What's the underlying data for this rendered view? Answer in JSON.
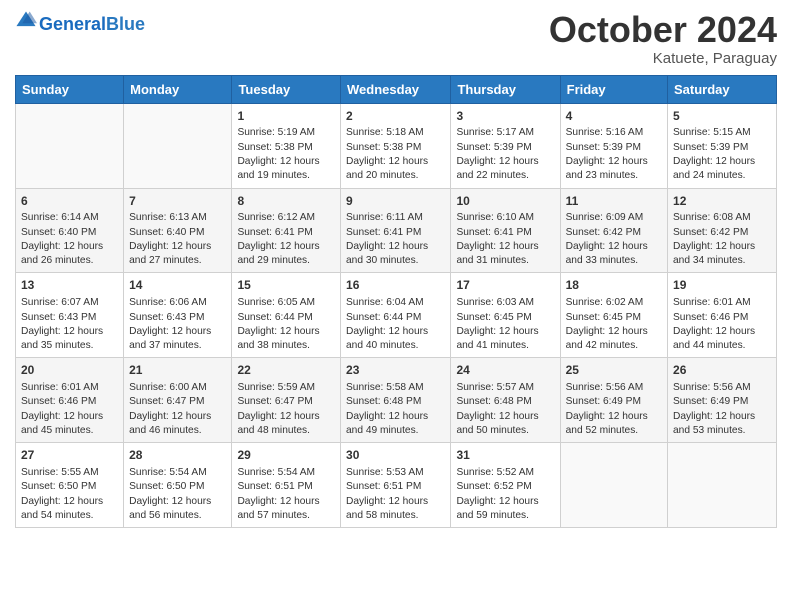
{
  "header": {
    "logo_general": "General",
    "logo_blue": "Blue",
    "month_title": "October 2024",
    "subtitle": "Katuete, Paraguay"
  },
  "weekdays": [
    "Sunday",
    "Monday",
    "Tuesday",
    "Wednesday",
    "Thursday",
    "Friday",
    "Saturday"
  ],
  "weeks": [
    [
      {
        "day": "",
        "sunrise": "",
        "sunset": "",
        "daylight": ""
      },
      {
        "day": "",
        "sunrise": "",
        "sunset": "",
        "daylight": ""
      },
      {
        "day": "1",
        "sunrise": "Sunrise: 5:19 AM",
        "sunset": "Sunset: 5:38 PM",
        "daylight": "Daylight: 12 hours and 19 minutes."
      },
      {
        "day": "2",
        "sunrise": "Sunrise: 5:18 AM",
        "sunset": "Sunset: 5:38 PM",
        "daylight": "Daylight: 12 hours and 20 minutes."
      },
      {
        "day": "3",
        "sunrise": "Sunrise: 5:17 AM",
        "sunset": "Sunset: 5:39 PM",
        "daylight": "Daylight: 12 hours and 22 minutes."
      },
      {
        "day": "4",
        "sunrise": "Sunrise: 5:16 AM",
        "sunset": "Sunset: 5:39 PM",
        "daylight": "Daylight: 12 hours and 23 minutes."
      },
      {
        "day": "5",
        "sunrise": "Sunrise: 5:15 AM",
        "sunset": "Sunset: 5:39 PM",
        "daylight": "Daylight: 12 hours and 24 minutes."
      }
    ],
    [
      {
        "day": "6",
        "sunrise": "Sunrise: 6:14 AM",
        "sunset": "Sunset: 6:40 PM",
        "daylight": "Daylight: 12 hours and 26 minutes."
      },
      {
        "day": "7",
        "sunrise": "Sunrise: 6:13 AM",
        "sunset": "Sunset: 6:40 PM",
        "daylight": "Daylight: 12 hours and 27 minutes."
      },
      {
        "day": "8",
        "sunrise": "Sunrise: 6:12 AM",
        "sunset": "Sunset: 6:41 PM",
        "daylight": "Daylight: 12 hours and 29 minutes."
      },
      {
        "day": "9",
        "sunrise": "Sunrise: 6:11 AM",
        "sunset": "Sunset: 6:41 PM",
        "daylight": "Daylight: 12 hours and 30 minutes."
      },
      {
        "day": "10",
        "sunrise": "Sunrise: 6:10 AM",
        "sunset": "Sunset: 6:41 PM",
        "daylight": "Daylight: 12 hours and 31 minutes."
      },
      {
        "day": "11",
        "sunrise": "Sunrise: 6:09 AM",
        "sunset": "Sunset: 6:42 PM",
        "daylight": "Daylight: 12 hours and 33 minutes."
      },
      {
        "day": "12",
        "sunrise": "Sunrise: 6:08 AM",
        "sunset": "Sunset: 6:42 PM",
        "daylight": "Daylight: 12 hours and 34 minutes."
      }
    ],
    [
      {
        "day": "13",
        "sunrise": "Sunrise: 6:07 AM",
        "sunset": "Sunset: 6:43 PM",
        "daylight": "Daylight: 12 hours and 35 minutes."
      },
      {
        "day": "14",
        "sunrise": "Sunrise: 6:06 AM",
        "sunset": "Sunset: 6:43 PM",
        "daylight": "Daylight: 12 hours and 37 minutes."
      },
      {
        "day": "15",
        "sunrise": "Sunrise: 6:05 AM",
        "sunset": "Sunset: 6:44 PM",
        "daylight": "Daylight: 12 hours and 38 minutes."
      },
      {
        "day": "16",
        "sunrise": "Sunrise: 6:04 AM",
        "sunset": "Sunset: 6:44 PM",
        "daylight": "Daylight: 12 hours and 40 minutes."
      },
      {
        "day": "17",
        "sunrise": "Sunrise: 6:03 AM",
        "sunset": "Sunset: 6:45 PM",
        "daylight": "Daylight: 12 hours and 41 minutes."
      },
      {
        "day": "18",
        "sunrise": "Sunrise: 6:02 AM",
        "sunset": "Sunset: 6:45 PM",
        "daylight": "Daylight: 12 hours and 42 minutes."
      },
      {
        "day": "19",
        "sunrise": "Sunrise: 6:01 AM",
        "sunset": "Sunset: 6:46 PM",
        "daylight": "Daylight: 12 hours and 44 minutes."
      }
    ],
    [
      {
        "day": "20",
        "sunrise": "Sunrise: 6:01 AM",
        "sunset": "Sunset: 6:46 PM",
        "daylight": "Daylight: 12 hours and 45 minutes."
      },
      {
        "day": "21",
        "sunrise": "Sunrise: 6:00 AM",
        "sunset": "Sunset: 6:47 PM",
        "daylight": "Daylight: 12 hours and 46 minutes."
      },
      {
        "day": "22",
        "sunrise": "Sunrise: 5:59 AM",
        "sunset": "Sunset: 6:47 PM",
        "daylight": "Daylight: 12 hours and 48 minutes."
      },
      {
        "day": "23",
        "sunrise": "Sunrise: 5:58 AM",
        "sunset": "Sunset: 6:48 PM",
        "daylight": "Daylight: 12 hours and 49 minutes."
      },
      {
        "day": "24",
        "sunrise": "Sunrise: 5:57 AM",
        "sunset": "Sunset: 6:48 PM",
        "daylight": "Daylight: 12 hours and 50 minutes."
      },
      {
        "day": "25",
        "sunrise": "Sunrise: 5:56 AM",
        "sunset": "Sunset: 6:49 PM",
        "daylight": "Daylight: 12 hours and 52 minutes."
      },
      {
        "day": "26",
        "sunrise": "Sunrise: 5:56 AM",
        "sunset": "Sunset: 6:49 PM",
        "daylight": "Daylight: 12 hours and 53 minutes."
      }
    ],
    [
      {
        "day": "27",
        "sunrise": "Sunrise: 5:55 AM",
        "sunset": "Sunset: 6:50 PM",
        "daylight": "Daylight: 12 hours and 54 minutes."
      },
      {
        "day": "28",
        "sunrise": "Sunrise: 5:54 AM",
        "sunset": "Sunset: 6:50 PM",
        "daylight": "Daylight: 12 hours and 56 minutes."
      },
      {
        "day": "29",
        "sunrise": "Sunrise: 5:54 AM",
        "sunset": "Sunset: 6:51 PM",
        "daylight": "Daylight: 12 hours and 57 minutes."
      },
      {
        "day": "30",
        "sunrise": "Sunrise: 5:53 AM",
        "sunset": "Sunset: 6:51 PM",
        "daylight": "Daylight: 12 hours and 58 minutes."
      },
      {
        "day": "31",
        "sunrise": "Sunrise: 5:52 AM",
        "sunset": "Sunset: 6:52 PM",
        "daylight": "Daylight: 12 hours and 59 minutes."
      },
      {
        "day": "",
        "sunrise": "",
        "sunset": "",
        "daylight": ""
      },
      {
        "day": "",
        "sunrise": "",
        "sunset": "",
        "daylight": ""
      }
    ]
  ]
}
